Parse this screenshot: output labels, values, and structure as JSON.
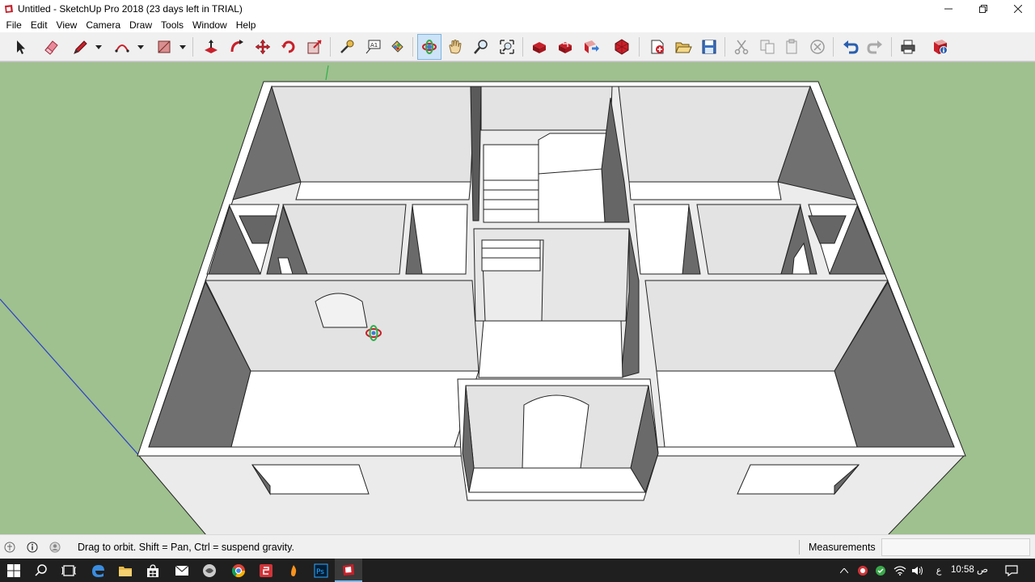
{
  "window": {
    "title": "Untitled - SketchUp Pro 2018 (23 days left in TRIAL)",
    "controls": [
      "minimize-icon",
      "restore-icon",
      "close-icon"
    ]
  },
  "menu": [
    "File",
    "Edit",
    "View",
    "Camera",
    "Draw",
    "Tools",
    "Window",
    "Help"
  ],
  "toolbar": {
    "active_tool": "Orbit",
    "tools": [
      "select-icon",
      "eraser-icon",
      "pencil-icon",
      "arc-icon",
      "rectangle-icon",
      "push-pull-icon",
      "follow-me-icon",
      "move-icon",
      "rotate-icon",
      "scale-icon",
      "tape-measure-icon",
      "text-icon",
      "paint-bucket-icon",
      "orbit-icon",
      "pan-icon",
      "zoom-icon",
      "zoom-extents-icon",
      "3d-warehouse-icon",
      "extension-warehouse-icon",
      "send-to-layout-icon",
      "extension-manager-icon",
      "new-icon",
      "open-icon",
      "save-icon",
      "cut-icon",
      "copy-icon",
      "paste-icon",
      "erase-icon",
      "undo-icon",
      "redo-icon",
      "print-icon",
      "model-info-icon"
    ],
    "colors": {
      "active_bg": "#cde3f7",
      "accent_red": "#c8202a"
    }
  },
  "viewport": {
    "sky_color": "#9fc08f",
    "model": "3d-house-floor-plan",
    "cursor": "orbit-cursor-icon"
  },
  "statusbar": {
    "hint": "Drag to orbit. Shift = Pan, Ctrl = suspend gravity.",
    "measurements_label": "Measurements",
    "measurements_value": ""
  },
  "taskbar": {
    "apps": [
      "start-icon",
      "search-icon",
      "task-view-icon",
      "edge-icon",
      "file-explorer-icon",
      "store-icon",
      "mail-icon",
      "app-icon",
      "chrome-icon",
      "app-red-icon",
      "app-orange-icon",
      "photoshop-icon",
      "sketchup-icon"
    ],
    "active_app": "sketchup-icon",
    "lang": "ع",
    "time": "10:58 ص"
  }
}
